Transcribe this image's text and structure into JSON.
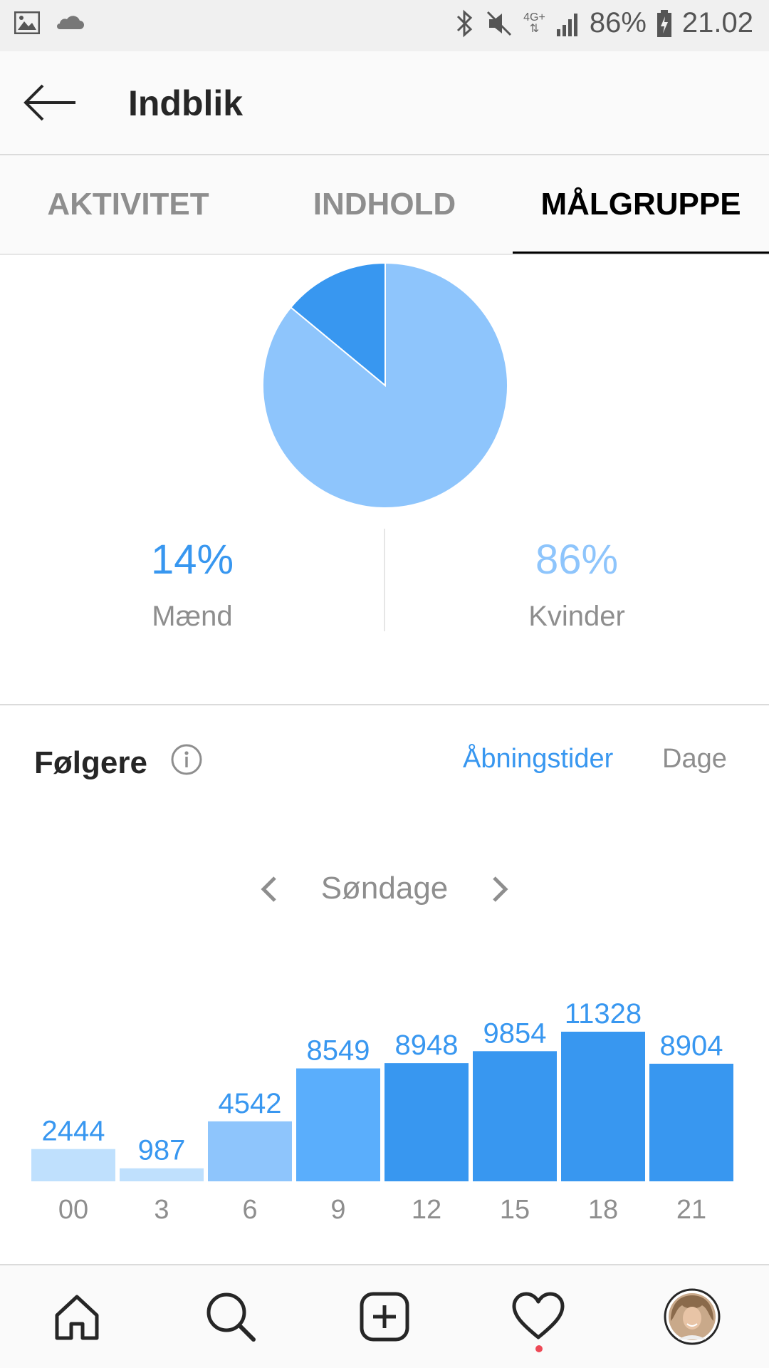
{
  "status_bar": {
    "network": "4G+",
    "battery": "86%",
    "time": "21.02",
    "icons": [
      "gallery-icon",
      "cloud-icon",
      "bluetooth-icon",
      "mute-icon",
      "signal-icon",
      "battery-icon"
    ]
  },
  "header": {
    "title": "Indblik",
    "back_icon": "back-arrow-icon"
  },
  "tabs": [
    {
      "label": "AKTIVITET",
      "active": false
    },
    {
      "label": "INDHOLD",
      "active": false
    },
    {
      "label": "MÅLGRUPPE",
      "active": true
    }
  ],
  "gender": {
    "men": {
      "percent": "14%",
      "label": "Mænd",
      "value": 14,
      "color": "#3897f0"
    },
    "women": {
      "percent": "86%",
      "label": "Kvinder",
      "value": 86,
      "color": "#8ec5fc"
    }
  },
  "followers": {
    "title": "Følgere",
    "info_icon": "info-icon",
    "link_hours": "Åbningstider",
    "link_days": "Dage",
    "day": "Søndage"
  },
  "chart_data": {
    "type": "bar",
    "categories": [
      "00",
      "3",
      "6",
      "9",
      "12",
      "15",
      "18",
      "21"
    ],
    "values": [
      2444,
      987,
      4542,
      8549,
      8948,
      9854,
      11328,
      8904
    ],
    "value_labels": [
      "2444",
      "987",
      "4542",
      "8549",
      "8948",
      "9854",
      "11328",
      "8904"
    ],
    "colors": [
      "#bfe0fd",
      "#bfe0fd",
      "#8ec5fc",
      "#5aaefc",
      "#3897f0",
      "#3897f0",
      "#3897f0",
      "#3897f0"
    ],
    "label_color": "#3897f0",
    "tick_color": "#8e8e8e",
    "ylim": [
      0,
      11328
    ]
  },
  "bottom_nav": [
    {
      "icon": "home-icon"
    },
    {
      "icon": "search-icon"
    },
    {
      "icon": "add-post-icon"
    },
    {
      "icon": "heart-icon"
    },
    {
      "icon": "profile-avatar"
    }
  ]
}
